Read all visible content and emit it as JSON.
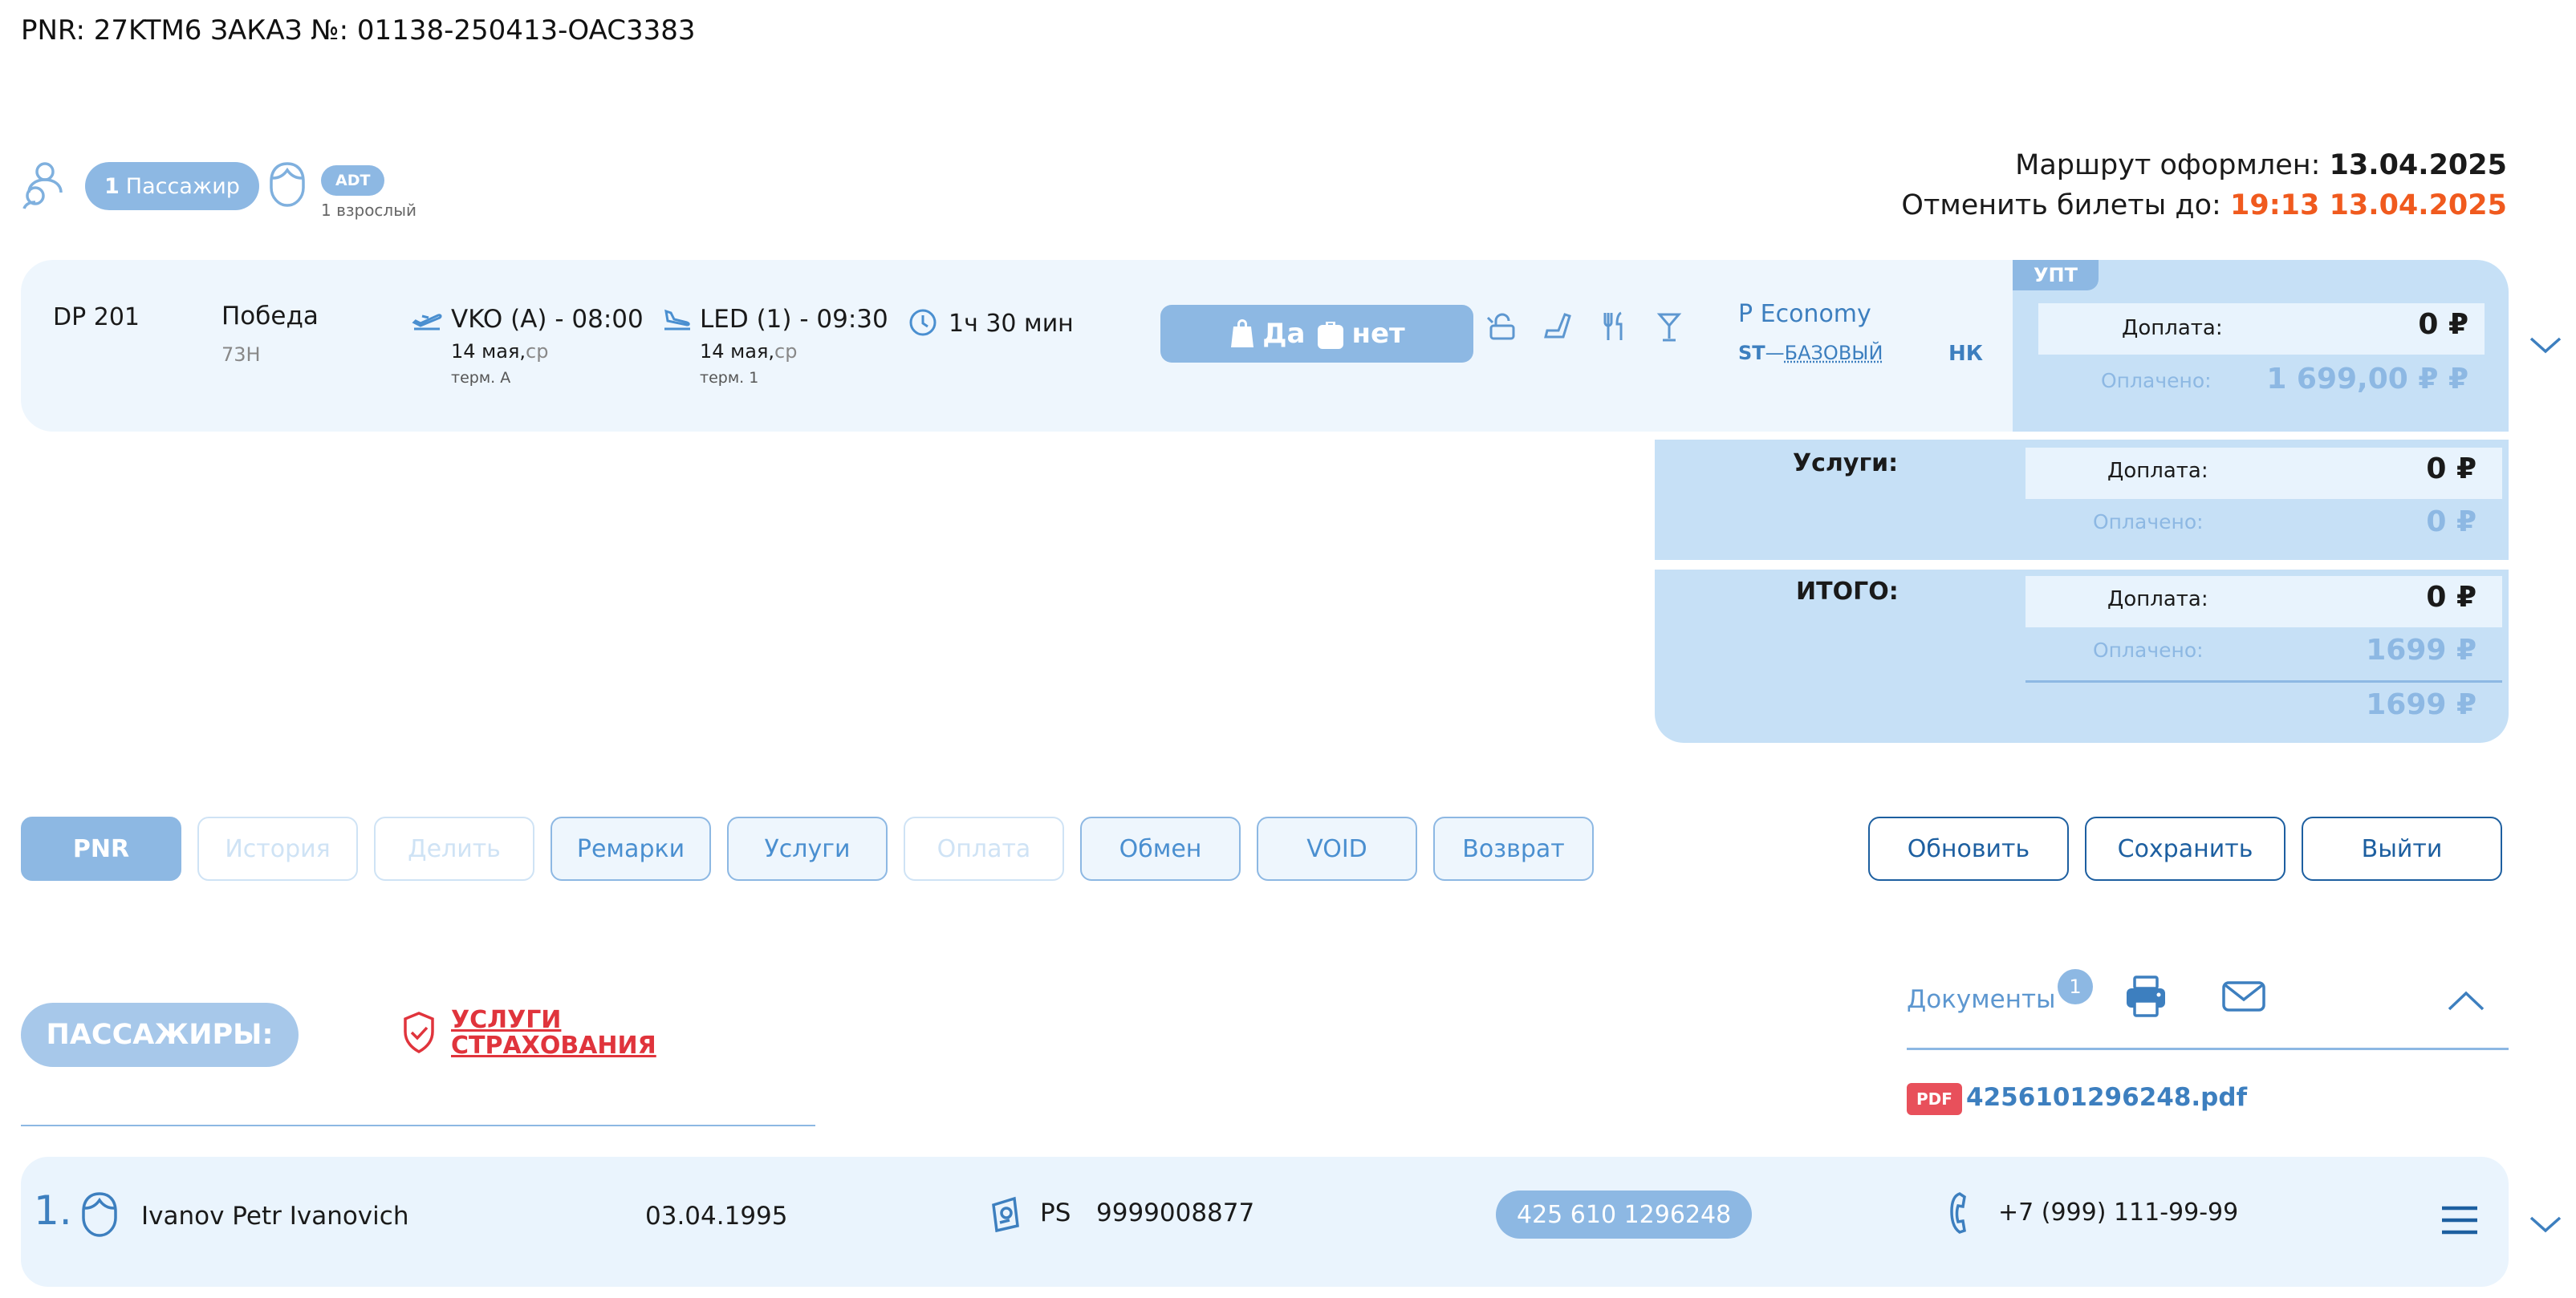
{
  "order": {
    "title": "PNR: 27KTM6 ЗАКАЗ №: 01138-250413-OAC3383",
    "route_issued_label": "Маршрут оформлен:",
    "route_issued_date": "13.04.2025",
    "cancel_label": "Отменить билеты до:",
    "cancel_deadline": "19:13 13.04.2025"
  },
  "passengers_summary": {
    "count_number": "1",
    "count_label": "Пассажир",
    "type_badge": "ADT",
    "type_caption": "1 взрослый"
  },
  "segment": {
    "flight_number": "DP 201",
    "airline": "Победа",
    "aircraft": "73H",
    "departure": "VKO (A) - 08:00",
    "departure_date": "14 мая,",
    "departure_weekday": "ср",
    "departure_terminal": "терм. A",
    "arrival": "LED (1) - 09:30",
    "arrival_date": "14 мая,",
    "arrival_weekday": "ср",
    "arrival_terminal": "терм. 1",
    "duration": "1ч 30 мин",
    "hand_luggage": "Да",
    "checked_baggage": "нет",
    "fare_class": "P Economy",
    "fare_basis_code": "ST",
    "fare_basis_sep": "—",
    "fare_basis_name": "БАЗОВЫЙ",
    "fare_flag": "НК",
    "amenity_icons": [
      "refund-lock-icon",
      "seat-icon",
      "meal-icon",
      "drink-icon"
    ]
  },
  "payment": {
    "tag": "УПТ",
    "surcharge_label": "Доплата:",
    "surcharge_value": "0 ₽",
    "paid_label": "Оплачено:",
    "paid_value": "1 699,00 ₽ ₽"
  },
  "services_summary": {
    "title": "Услуги:",
    "surcharge_label": "Доплата:",
    "surcharge_value": "0 ₽",
    "paid_label": "Оплачено:",
    "paid_value": "0 ₽"
  },
  "total_summary": {
    "title": "ИТОГО:",
    "surcharge_label": "Доплата:",
    "surcharge_value": "0 ₽",
    "paid_label": "Оплачено:",
    "paid_value": "1699 ₽",
    "total_value": "1699 ₽"
  },
  "actions": {
    "pnr": "PNR",
    "history": "История",
    "split": "Делить",
    "remarks": "Ремарки",
    "services": "Услуги",
    "payment": "Оплата",
    "exchange": "Обмен",
    "void": "VOID",
    "refund": "Возврат",
    "refresh": "Обновить",
    "save": "Сохранить",
    "exit": "Выйти"
  },
  "passengers_section": {
    "header": "ПАССАЖИРЫ:",
    "insurance_line1": "УСЛУГИ",
    "insurance_line2": "СТРАХОВАНИЯ"
  },
  "documents": {
    "title": "Документы",
    "count": "1",
    "file_type": "PDF",
    "file_name": "4256101296248.pdf"
  },
  "passenger_rows": [
    {
      "index": "1.",
      "name": "Ivanov Petr Ivanovich",
      "birth_date": "03.04.1995",
      "doc_type": "PS",
      "doc_number": "9999008877",
      "ticket": "425 610 1296248",
      "phone": "+7 (999) 111-99-99"
    }
  ],
  "colors": {
    "accent": "#8db8e3",
    "accent_dark": "#1d5fa0",
    "link_blue": "#3d7fbf",
    "deadline": "#f05a1e",
    "insurance_red": "#e0343c",
    "panel": "#c6e0f6",
    "card": "#eef6fd"
  }
}
